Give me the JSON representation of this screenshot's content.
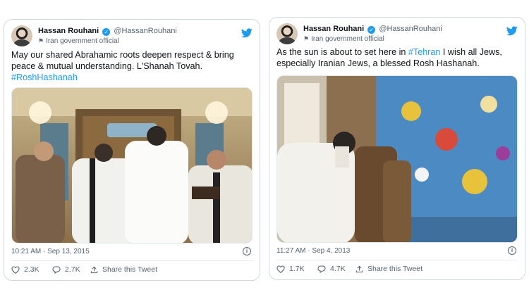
{
  "tweets": [
    {
      "display_name": "Hassan Rouhani",
      "handle": "@HassanRouhani",
      "account_label": "Iran government official",
      "text_main": "May our shared Abrahamic roots deepen respect & bring peace & mutual understanding. L'Shanah Tovah.",
      "hashtag": "#RoshHashanah",
      "timestamp": "10:21 AM · Sep 13, 2015",
      "likes": "2.3K",
      "replies": "2.7K",
      "share_label": "Share this Tweet"
    },
    {
      "display_name": "Hassan Rouhani",
      "handle": "@HassanRouhani",
      "account_label": "Iran government official",
      "text_before": "As the sun is about to set here in ",
      "hashtag": "#Tehran",
      "text_after": " I wish all Jews, especially Iranian Jews, a blessed Rosh Hashanah.",
      "timestamp": "11:27 AM · Sep 4, 2013",
      "likes": "1.7K",
      "replies": "4.7K",
      "share_label": "Share this Tweet"
    }
  ],
  "icons": {
    "verified": "verified-badge-icon",
    "account_label": "flag-icon",
    "brand": "twitter-bird-icon",
    "info": "info-icon",
    "like": "heart-icon",
    "reply": "speech-bubble-icon",
    "share": "share-arrow-icon"
  },
  "colors": {
    "accent": "#1d9bf0",
    "secondary_text": "#536471",
    "border": "#cfd9de"
  }
}
